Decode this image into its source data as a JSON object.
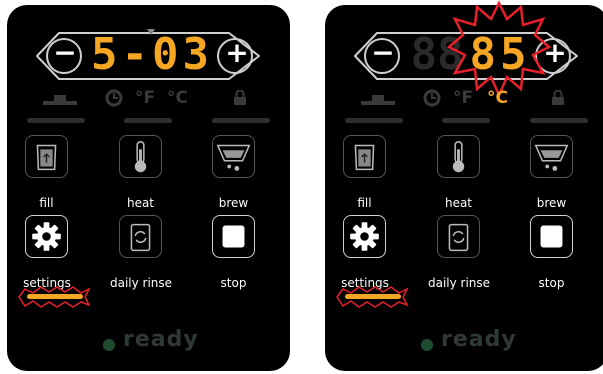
{
  "colors": {
    "accent": "#f5a623",
    "dim_segment": "#2a2a2a",
    "highlight": "#e8202a",
    "ready_dot": "#1f4d2f"
  },
  "panels": [
    {
      "display_value": "5-03",
      "minus_label": "−",
      "plus_label": "+",
      "units": {
        "fahrenheit": "°F",
        "celsius": "°C",
        "celsius_active": false
      },
      "icons_row": [
        "warmer-icon",
        "timer-icon",
        "lock-icon"
      ],
      "buttons": [
        {
          "label": "fill",
          "icon": "fill-icon"
        },
        {
          "label": "heat",
          "icon": "thermometer-icon"
        },
        {
          "label": "brew",
          "icon": "brew-icon"
        },
        {
          "label": "settings",
          "icon": "gear-icon"
        },
        {
          "label": "daily rinse",
          "icon": "rinse-icon"
        },
        {
          "label": "stop",
          "icon": "stop-icon"
        }
      ],
      "settings_bar_lit": true,
      "status": "ready"
    },
    {
      "display_value": "85",
      "minus_label": "−",
      "plus_label": "+",
      "units": {
        "fahrenheit": "°F",
        "celsius": "°C",
        "celsius_active": true
      },
      "icons_row": [
        "warmer-icon",
        "timer-icon",
        "lock-icon"
      ],
      "buttons": [
        {
          "label": "fill",
          "icon": "fill-icon"
        },
        {
          "label": "heat",
          "icon": "thermometer-icon"
        },
        {
          "label": "brew",
          "icon": "brew-icon"
        },
        {
          "label": "settings",
          "icon": "gear-icon"
        },
        {
          "label": "daily rinse",
          "icon": "rinse-icon"
        },
        {
          "label": "stop",
          "icon": "stop-icon"
        }
      ],
      "settings_bar_lit": true,
      "status": "ready"
    }
  ]
}
